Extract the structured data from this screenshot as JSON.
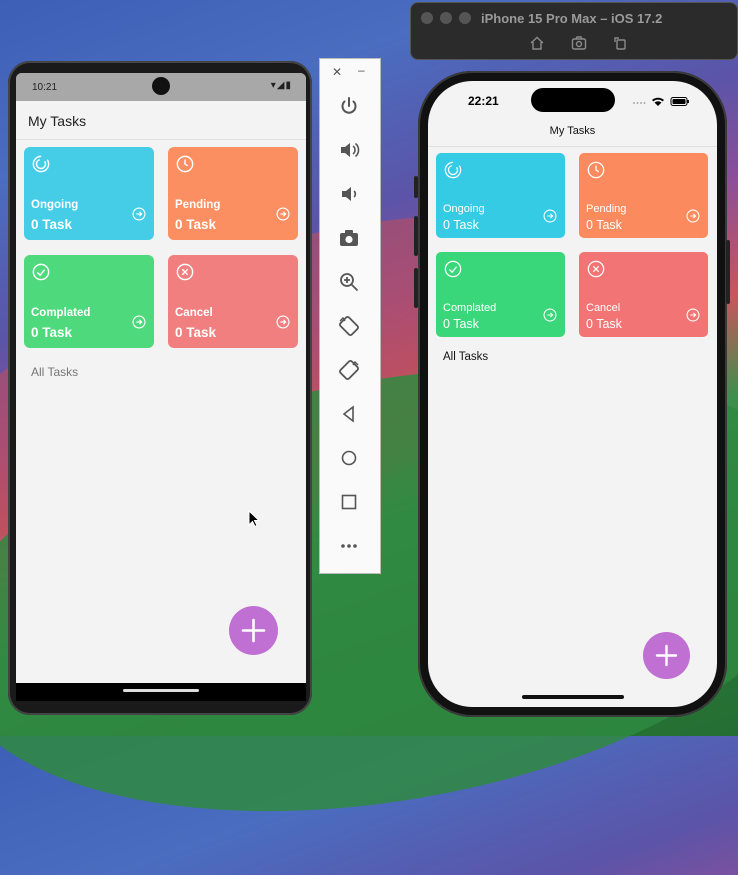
{
  "android": {
    "status_time": "10:21",
    "app_title": "My Tasks",
    "cards": [
      {
        "label": "Ongoing",
        "count": "0 Task",
        "color": "#45cde8",
        "icon": "ongoing-icon"
      },
      {
        "label": "Pending",
        "count": "0 Task",
        "color": "#fc8f62",
        "icon": "clock-icon"
      },
      {
        "label": "Complated",
        "count": "0 Task",
        "color": "#4fd97d",
        "icon": "check-circle-icon"
      },
      {
        "label": "Cancel",
        "count": "0 Task",
        "color": "#f27f7f",
        "icon": "cancel-circle-icon"
      }
    ],
    "all_tasks_label": "All Tasks",
    "fab_color": "#c06fd2"
  },
  "emulator_toolbar": {
    "buttons": [
      "power",
      "volume-up",
      "volume-down",
      "camera",
      "zoom",
      "rotate-left",
      "rotate-right",
      "back",
      "home",
      "overview",
      "more"
    ]
  },
  "simulator": {
    "window_title": "iPhone 15 Pro Max – iOS 17.2"
  },
  "iphone": {
    "status_time": "22:21",
    "app_title": "My Tasks",
    "cards": [
      {
        "label": "Ongoing",
        "count": "0 Task",
        "color": "#36cbe5",
        "icon": "ongoing-icon"
      },
      {
        "label": "Pending",
        "count": "0 Task",
        "color": "#fb8b5f",
        "icon": "clock-icon"
      },
      {
        "label": "Complated",
        "count": "0 Task",
        "color": "#3ad77a",
        "icon": "check-circle-icon"
      },
      {
        "label": "Cancel",
        "count": "0 Task",
        "color": "#f27474",
        "icon": "cancel-circle-icon"
      }
    ],
    "all_tasks_label": "All Tasks",
    "fab_color": "#c06fd2"
  }
}
